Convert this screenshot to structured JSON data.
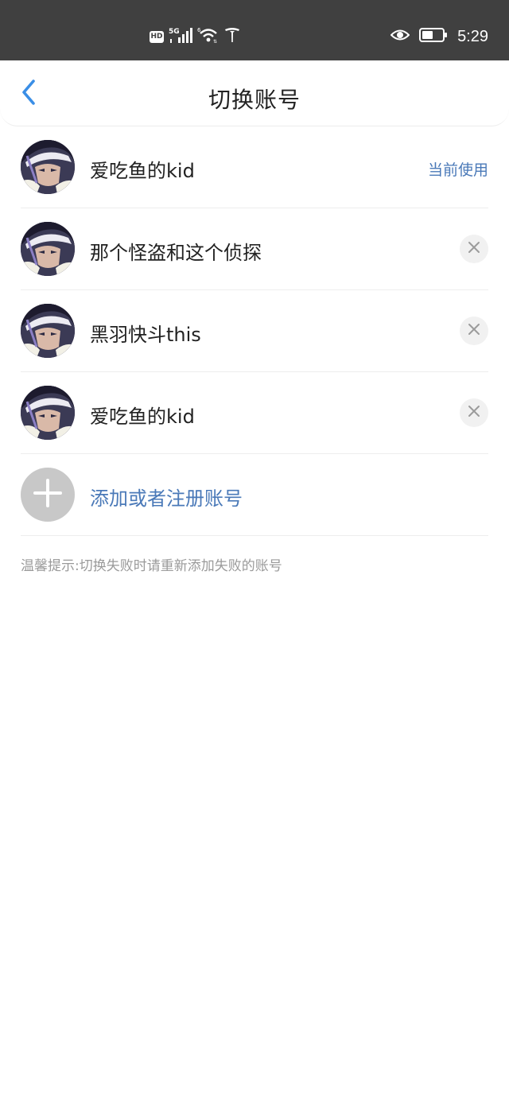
{
  "status_bar": {
    "left_icons": [
      "hd-badge",
      "5g-signal-icon",
      "wifi-icon",
      "tesla-logo-icon"
    ],
    "hd_label": "HD",
    "network_label": "5G",
    "right_icons": [
      "eye-icon",
      "battery-icon"
    ],
    "time": "5:29"
  },
  "header": {
    "title": "切换账号",
    "back_icon": "chevron-left-icon",
    "accent_color": "#3a8ee6"
  },
  "accounts": [
    {
      "name": "爱吃鱼的kid",
      "status": "当前使用"
    },
    {
      "name": "那个怪盗和这个侦探",
      "action_icon": "close-icon"
    },
    {
      "name": "黑羽快斗this",
      "action_icon": "close-icon"
    },
    {
      "name": "爱吃鱼的kid",
      "action_icon": "close-icon"
    }
  ],
  "add_account": {
    "label": "添加或者注册账号",
    "icon": "plus-icon"
  },
  "tip": "温馨提示:切换失败时请重新添加失败的账号",
  "colors": {
    "link": "#4a79b8",
    "status_bar_bg": "#404040"
  }
}
